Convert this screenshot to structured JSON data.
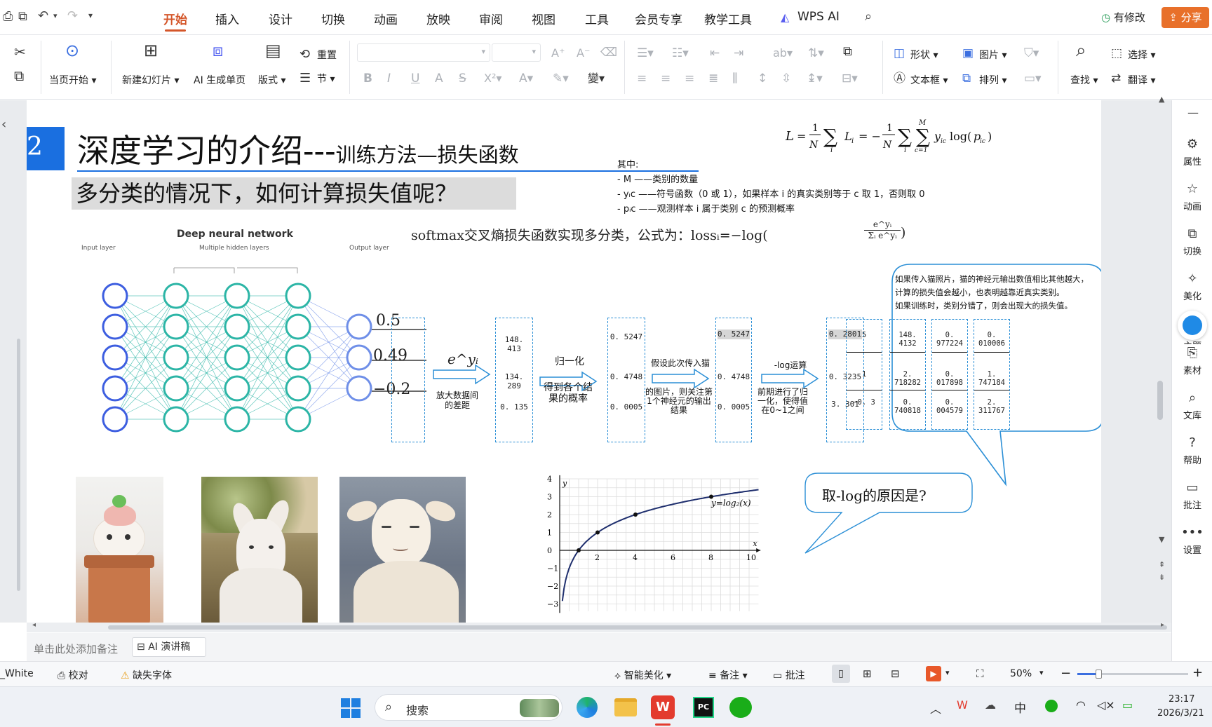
{
  "menubar": {
    "tabs": [
      "开始",
      "插入",
      "设计",
      "切换",
      "动画",
      "放映",
      "审阅",
      "视图",
      "工具",
      "会员专享",
      "教学工具",
      "WPS AI"
    ],
    "active_tab": "开始",
    "modify_label": "有修改",
    "share_label": "分享"
  },
  "ribbon": {
    "play_current": "当页开始",
    "new_slide": "新建幻灯片",
    "ai_page": "AI 生成单页",
    "layout": "版式",
    "reset": "重置",
    "section": "节",
    "shape": "形状",
    "picture": "图片",
    "textbox": "文本框",
    "arrange": "排列",
    "find": "查找",
    "select": "选择",
    "translate": "翻译"
  },
  "slide": {
    "number": "2",
    "title_main": "深度学习的介绍---",
    "title_sub": "训练方法—损失函数",
    "question": "多分类的情况下，如何计算损失值呢？",
    "formula_main": "L = (1/N) Σᵢ Lᵢ = −(1/N) Σᵢ Σc=1..M yᵢc log(pᵢc)",
    "where_title": "其中:",
    "where_lines": [
      "- M ——类别的数量",
      "- yᵢc ——符号函数（0 或 1），如果样本 i 的真实类别等于 c 取 1，否则取 0",
      "- pᵢc ——观测样本 i 属于类别 c 的预测概率"
    ],
    "softmax_text": "softmax交叉熵损失函数实现多分类，公式为：lossᵢ=−log(",
    "softmax_frac_num": "e^yᵢ",
    "softmax_frac_den": "Σᵢ e^yᵢ",
    "nn_title": "Deep neural network",
    "nn_input": "Input layer",
    "nn_hidden": "Multiple hidden layers",
    "nn_output": "Output layer",
    "outputs": [
      "0.5",
      "0.49",
      "−0.2"
    ],
    "step1_label": "e^yᵢ",
    "step1_note": "放大数据间的差距",
    "box1": [
      "148. 413",
      "134. 289",
      "0. 135"
    ],
    "step2_label": "归一化",
    "step2_note": "得到各个结果的概率",
    "box2": [
      "0. 5247",
      "0. 4748",
      "0. 0005"
    ],
    "step3_label": "假设此次传入猫",
    "step3_note": "的图片，则关注第1个神经元的输出结果",
    "box3": [
      "0. 5247",
      "0. 4748",
      "0. 0005"
    ],
    "step4_label": "-log运算",
    "step4_note": "前期进行了归一化，使得值在0~1之间",
    "box4": [
      "0. 2801",
      "0. 3235",
      "3. 301"
    ],
    "bubble_text": [
      "如果传入猫照片，猫的神经元输出数值相比其他越大，",
      "计算的损失值会越小，也表明越靠近真实类别。",
      "如果训练时，类别分错了，则会出现大的损失值。"
    ],
    "bubble_cols": [
      [
        "5",
        "1",
        "−0. 3"
      ],
      [
        "148. 4132",
        "2. 718282",
        "0. 740818"
      ],
      [
        "0. 977224",
        "0. 017898",
        "0. 004579"
      ],
      [
        "0. 010006",
        "1. 747184",
        "2. 311767"
      ]
    ],
    "why_log": "取-log的原因是?",
    "graph_label": "y=log₂(x)",
    "graph_x_ticks": [
      "2",
      "4",
      "6",
      "8",
      "10"
    ],
    "graph_y_ticks": [
      "4",
      "3",
      "2",
      "1",
      "0",
      "−1",
      "−2",
      "−3"
    ],
    "graph_x_var": "x",
    "graph_y_var": "y",
    "images": [
      "cat-in-pot",
      "bull-terrier",
      "lamb"
    ]
  },
  "notes": {
    "add_note": "单击此处添加备注",
    "ai_script": "AI 演讲稿"
  },
  "right_panel": [
    "属性",
    "动画",
    "切换",
    "美化",
    "主题",
    "素材",
    "文库",
    "帮助",
    "批注",
    "设置"
  ],
  "statusbar": {
    "theme": "White",
    "proof": "校对",
    "missing_font": "缺失字体",
    "smart_beautify": "智能美化",
    "notes": "备注",
    "comment": "批注",
    "zoom": "50%"
  },
  "taskbar": {
    "search": "搜索",
    "ime": "中",
    "time": "23:17",
    "date": "2026/3/21"
  },
  "colors": {
    "accent": "#d4562a",
    "slide_blue": "#1a6fe0",
    "dash_blue": "#2b8fd6",
    "neuron_blue": "#3d5ee0",
    "neuron_teal": "#2cb5a6"
  }
}
